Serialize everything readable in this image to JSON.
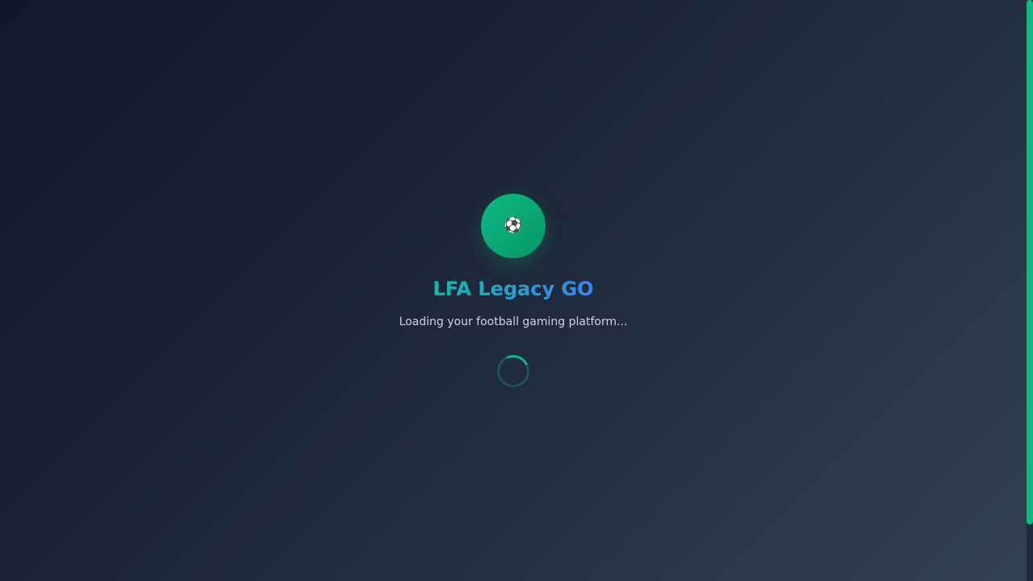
{
  "app": {
    "title": "LFA Legacy GO",
    "subtitle": "Loading your football gaming platform...",
    "logo_icon": "⚽"
  },
  "colors": {
    "accent": "#10b981",
    "title_gradient_start": "#14b8a6",
    "title_gradient_end": "#3b82f6",
    "subtitle": "#cbd5e1"
  },
  "icons": {
    "logo": "soccer-ball-icon",
    "loader": "loading-spinner-icon"
  }
}
